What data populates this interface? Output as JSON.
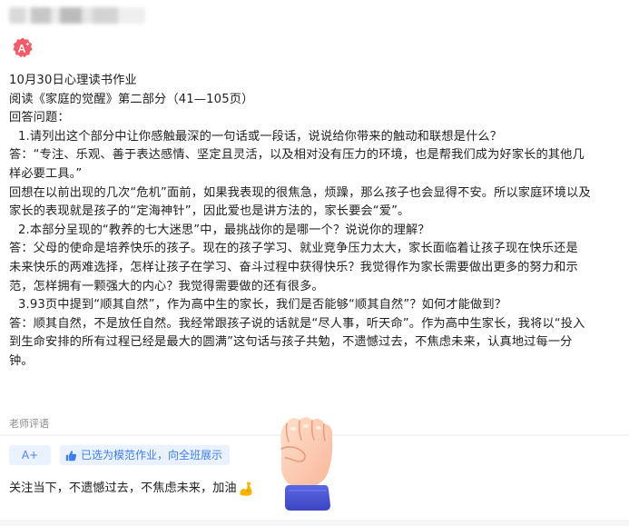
{
  "header": {
    "avatar_icon": "grade-a-plus-icon",
    "grade_text": "A+"
  },
  "post": {
    "title": "10月30日心理读书作业",
    "subtitle": "阅读《家庭的觉醒》第二部分（41—105页）",
    "answer_label": "回答问题：",
    "q1": "1.请列出这个部分中让你感触最深的一句话或一段话，说说给你带来的触动和联想是什么？",
    "a1_line1": "答：“专注、乐观、善于表达感情、坚定且灵活，以及相对没有压力的环境，也是帮我们成为好家长的其他几",
    "a1_line2": "样必要工具。”",
    "a1_line3": "回想在以前出现的几次“危机”面前，如果我表现的很焦急，烦躁，那么孩子也会显得不安。所以家庭环境以及",
    "a1_line4": "家长的表现就是孩子的“定海神针”，因此爱也是讲方法的，家长要会“爱”。",
    "q2": "2.本部分呈现的“教养的七大迷思”中，最挑战你的是哪一个？说说你的理解？",
    "a2_line1": "答：父母的使命是培养快乐的孩子。现在的孩子学习、就业竞争压力太大，家长面临着让孩子现在快乐还是",
    "a2_line2": "未来快乐的两难选择，怎样让孩子在学习、奋斗过程中获得快乐？我觉得作为家长需要做出更多的努力和示",
    "a2_line3": "范，怎样拥有一颗强大的内心？我觉得需要做的还有很多。",
    "q3": "3.93页中提到“顺其自然”，作为高中生的家长，我们是否能够“顺其自然”？如何才能做到？",
    "a3_line1": "答：顺其自然，不是放任自然。我经常跟孩子说的话就是“尽人事，听天命”。作为高中生家长，我将以“投入",
    "a3_line2": "到生命安排的所有过程已经是最大的圆满”这句话与孩子共勉，不遗憾过去，不焦虑未来，认真地过每一分",
    "a3_line3": "钟。"
  },
  "review": {
    "label": "老师评语",
    "grade_chip": "A+",
    "model_chip": "已选为模范作业，向全班展示",
    "model_icon": "thumbs-up-icon",
    "comment": "关注当下，不遗憾过去，不焦虑未来，加油",
    "comment_emoji": "flexed-biceps-icon",
    "sticker": "raised-fist-sticker"
  },
  "colors": {
    "badge": "#f45b69",
    "chip_bg": "#eaf2ff",
    "chip_text": "#3d7ef0",
    "fist_skin": "#ffd2b8",
    "fist_cuff": "#4a56d8"
  }
}
